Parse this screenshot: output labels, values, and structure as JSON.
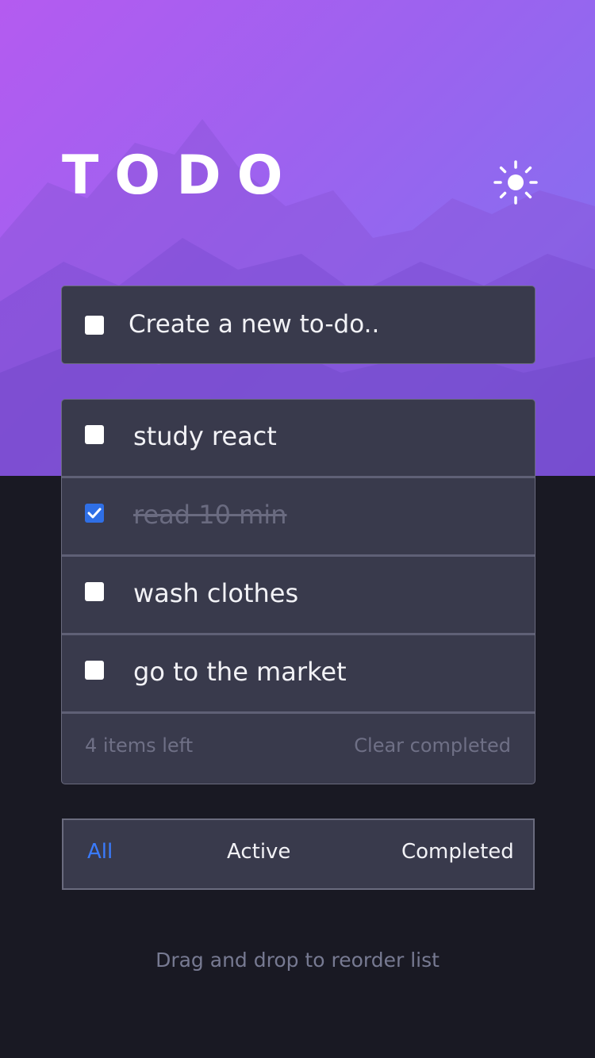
{
  "header": {
    "title": "TODO",
    "theme_icon": "sun-icon"
  },
  "new_todo": {
    "placeholder": "Create a new to-do.."
  },
  "todos": [
    {
      "text": "study react",
      "completed": false
    },
    {
      "text": "read 10 min",
      "completed": true
    },
    {
      "text": "wash clothes",
      "completed": false
    },
    {
      "text": "go to the market",
      "completed": false
    }
  ],
  "footer": {
    "items_left": "4 items left",
    "clear_label": "Clear completed"
  },
  "filters": {
    "all": "All",
    "active": "Active",
    "completed": "Completed",
    "selected": "All"
  },
  "hint": "Drag and drop to reorder list",
  "colors": {
    "accent": "#3a7bfd",
    "card": "#393a4c",
    "background": "#191923",
    "hero_start": "#b45bf0",
    "hero_end": "#7a5ae0"
  }
}
